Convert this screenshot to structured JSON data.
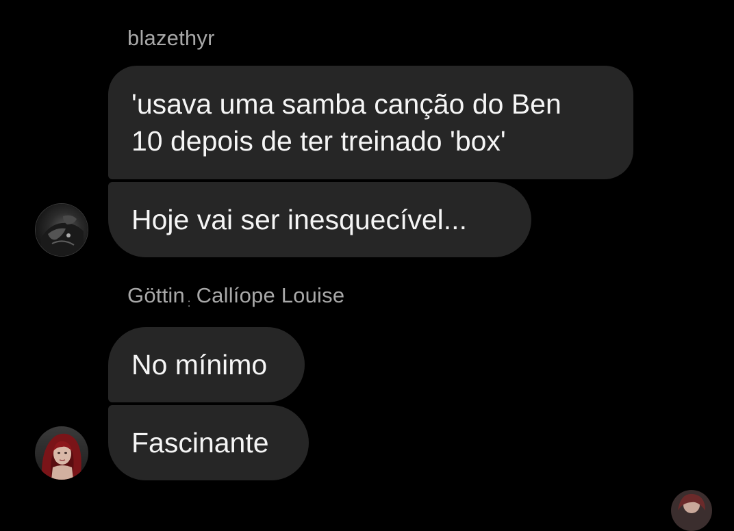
{
  "conversation": {
    "groups": [
      {
        "sender": {
          "name": "blazethyr",
          "avatar_icon": "user-avatar-dark-photo"
        },
        "messages": [
          {
            "lines": [
              "'usava uma samba canção do Ben",
              "10 depois de ter treinado 'box'"
            ]
          },
          {
            "lines": [
              "Hoje vai ser inesquecível..."
            ]
          }
        ]
      },
      {
        "sender": {
          "name": "Göttin",
          "separator": ":",
          "nickname": "Callíope Louise",
          "avatar_icon": "user-avatar-redhair-photo"
        },
        "messages": [
          {
            "lines": [
              "No mínimo"
            ]
          },
          {
            "lines": [
              "Fascinante"
            ]
          }
        ]
      }
    ]
  },
  "colors": {
    "background": "#000000",
    "bubble": "#262626",
    "message_text": "#f5f5f5",
    "sender_name": "#a8a8a8"
  }
}
